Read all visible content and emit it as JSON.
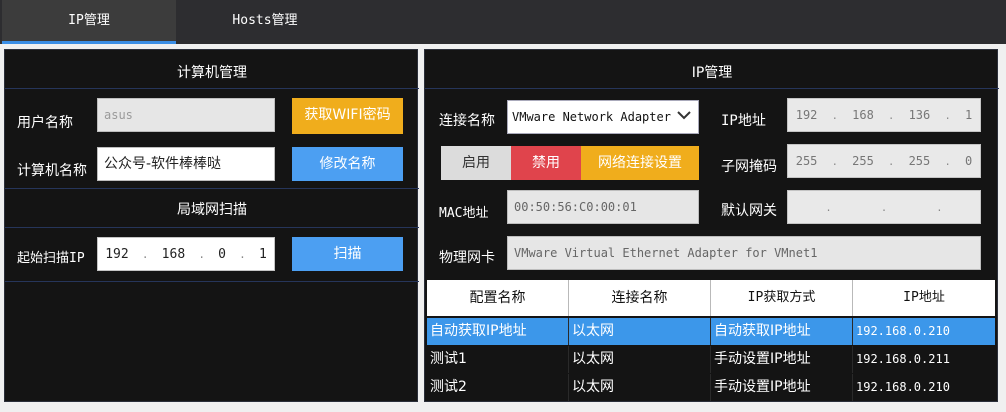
{
  "tabs": [
    {
      "label": "IP管理",
      "active": true
    },
    {
      "label": "Hosts管理",
      "active": false
    }
  ],
  "computer_panel": {
    "title": "计算机管理",
    "username_label": "用户名称",
    "username_value": "asus",
    "get_wifi_button": "获取WIFI密码",
    "computer_name_label": "计算机名称",
    "computer_name_value": "公众号-软件棒棒哒",
    "rename_button": "修改名称"
  },
  "scan_panel": {
    "title": "局域网扫描",
    "start_ip_label": "起始扫描IP",
    "start_ip": [
      "192",
      "168",
      "0",
      "1"
    ],
    "scan_button": "扫描"
  },
  "ip_panel": {
    "title": "IP管理",
    "connection_label": "连接名称",
    "connection_value": "VMware Network Adapter",
    "enable_button": "启用",
    "disable_button": "禁用",
    "net_settings_button": "网络连接设置",
    "mac_label": "MAC地址",
    "mac_value": "00:50:56:C0:00:01",
    "nic_label": "物理网卡",
    "nic_value": "VMware Virtual Ethernet Adapter for VMnet1",
    "ip_label": "IP地址",
    "ip_value": [
      "192",
      "168",
      "136",
      "1"
    ],
    "mask_label": "子网掩码",
    "mask_value": [
      "255",
      "255",
      "255",
      "0"
    ],
    "gateway_label": "默认网关",
    "gateway_value": [
      "",
      "",
      "",
      ""
    ]
  },
  "table": {
    "headers": [
      "配置名称",
      "连接名称",
      "IP获取方式",
      "IP地址"
    ],
    "rows": [
      {
        "name": "自动获取IP地址",
        "conn": "以太网",
        "mode": "自动获取IP地址",
        "ip": "192.168.0.210",
        "selected": true
      },
      {
        "name": "测试1",
        "conn": "以太网",
        "mode": "手动设置IP地址",
        "ip": "192.168.0.211",
        "selected": false
      },
      {
        "name": "测试2",
        "conn": "以太网",
        "mode": "手动设置IP地址",
        "ip": "192.168.0.210",
        "selected": false
      }
    ]
  },
  "colors": {
    "accent": "#3a8ee6",
    "orange": "#f0ad1c",
    "blue": "#4c9ff2",
    "red": "#e0444c",
    "selection": "#3c97ea"
  },
  "icons": {
    "select_arrow": "chevron-down-icon"
  }
}
